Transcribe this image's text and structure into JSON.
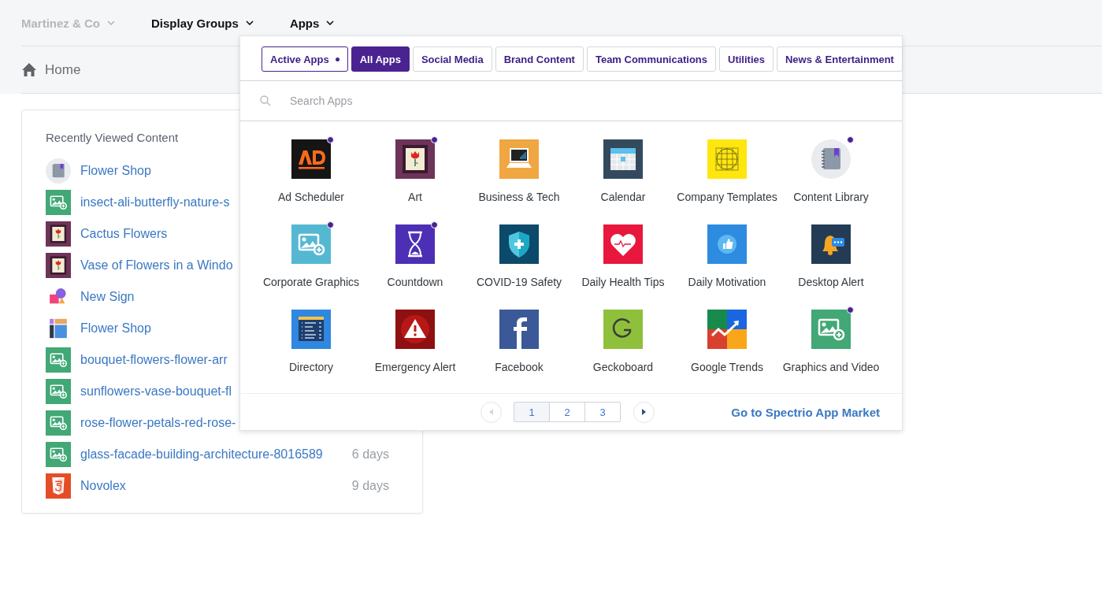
{
  "top_nav": [
    {
      "label": "Martinez & Co",
      "muted": true
    },
    {
      "label": "Display Groups",
      "muted": false
    },
    {
      "label": "Apps",
      "muted": false
    }
  ],
  "breadcrumb": {
    "label": "Home"
  },
  "recent": {
    "title": "Recently Viewed Content",
    "items": [
      {
        "title": "Flower Shop"
      },
      {
        "title": "insect-ali-butterfly-nature-s"
      },
      {
        "title": "Cactus Flowers"
      },
      {
        "title": "Vase of Flowers in a Windo"
      },
      {
        "title": "New Sign"
      },
      {
        "title": "Flower Shop"
      },
      {
        "title": "bouquet-flowers-flower-arr"
      },
      {
        "title": "sunflowers-vase-bouquet-fl"
      },
      {
        "title": "rose-flower-petals-red-rose-"
      },
      {
        "title": "glass-facade-building-architecture-8016589",
        "time": "6 days"
      },
      {
        "title": "Novolex",
        "time": "9 days"
      }
    ]
  },
  "apps_menu": {
    "tabs": [
      {
        "label": "Active Apps",
        "selected": false,
        "indicator": true
      },
      {
        "label": "All Apps",
        "selected": true,
        "indicator": false
      },
      {
        "label": "Social Media",
        "selected": false,
        "indicator": false
      },
      {
        "label": "Brand Content",
        "selected": false,
        "indicator": false
      },
      {
        "label": "Team Communications",
        "selected": false,
        "indicator": false
      },
      {
        "label": "Utilities",
        "selected": false,
        "indicator": false
      },
      {
        "label": "News & Entertainment",
        "selected": false,
        "indicator": false
      }
    ],
    "search": {
      "placeholder": "Search Apps"
    },
    "apps": [
      {
        "name": "Ad Scheduler",
        "active": true
      },
      {
        "name": "Art",
        "active": true
      },
      {
        "name": "Business & Tech",
        "active": false
      },
      {
        "name": "Calendar",
        "active": false
      },
      {
        "name": "Company Templates",
        "active": false
      },
      {
        "name": "Content Library",
        "active": true
      },
      {
        "name": "Corporate Graphics",
        "active": true
      },
      {
        "name": "Countdown",
        "active": true
      },
      {
        "name": "COVID-19 Safety",
        "active": false
      },
      {
        "name": "Daily Health Tips",
        "active": false
      },
      {
        "name": "Daily Motivation",
        "active": false
      },
      {
        "name": "Desktop Alert",
        "active": false
      },
      {
        "name": "Directory",
        "active": false
      },
      {
        "name": "Emergency Alert",
        "active": false
      },
      {
        "name": "Facebook",
        "active": false
      },
      {
        "name": "Geckoboard",
        "active": false
      },
      {
        "name": "Google Trends",
        "active": false
      },
      {
        "name": "Graphics and Video",
        "active": true
      }
    ],
    "pagination": {
      "prev_disabled": true,
      "next_disabled": false,
      "pages": [
        {
          "label": "1",
          "selected": true
        },
        {
          "label": "2",
          "selected": false
        },
        {
          "label": "3",
          "selected": false
        }
      ]
    },
    "market_link": "Go to Spectrio App Market"
  }
}
